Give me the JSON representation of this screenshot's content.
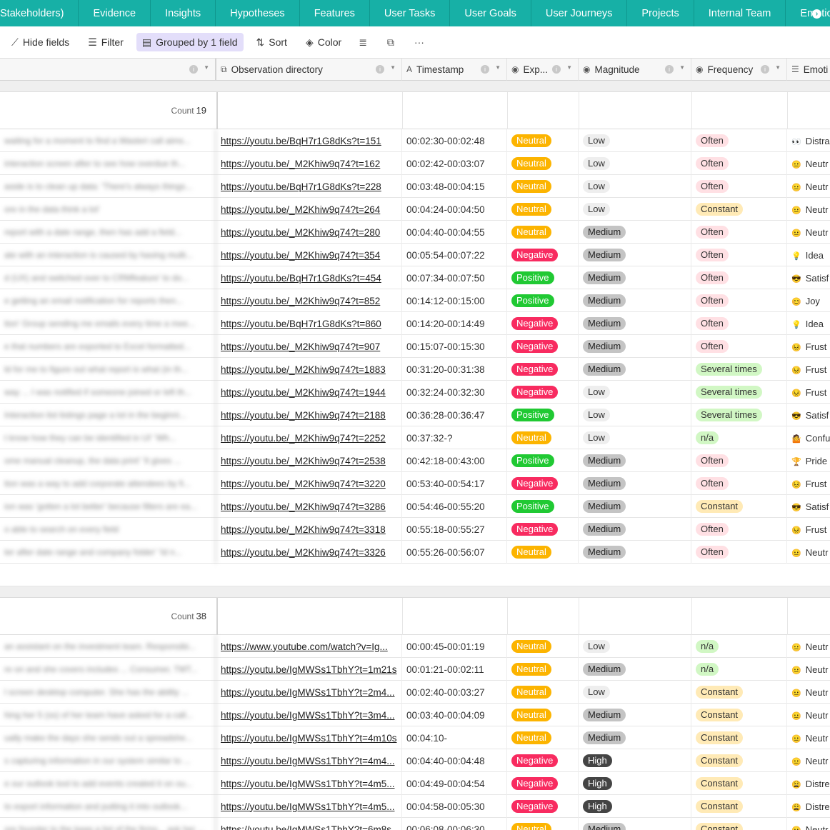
{
  "tabs": [
    {
      "label": "Stakeholders)"
    },
    {
      "label": "Evidence"
    },
    {
      "label": "Insights"
    },
    {
      "label": "Hypotheses"
    },
    {
      "label": "Features"
    },
    {
      "label": "User Tasks"
    },
    {
      "label": "User Goals"
    },
    {
      "label": "User Journeys"
    },
    {
      "label": "Projects"
    },
    {
      "label": "Internal Team"
    },
    {
      "label": "Emotio"
    }
  ],
  "toolbar": {
    "hide_fields": "Hide fields",
    "filter": "Filter",
    "grouped": "Grouped by 1 field",
    "sort": "Sort",
    "color": "Color"
  },
  "columns": {
    "observation": "Observation directory",
    "timestamp": "Timestamp",
    "experience": "Exp...",
    "magnitude": "Magnitude",
    "frequency": "Frequency",
    "emotion": "Emoti"
  },
  "groups": [
    {
      "count_label": "Count",
      "count": "19",
      "rows": [
        {
          "blur": "waiting for a moment to find a Wasteri call aims...",
          "link": "https://youtu.be/BqH7r1G8dKs?t=151",
          "time": "00:02:30-00:02:48",
          "exp": "Neutral",
          "mag": "Low",
          "freq": "Often",
          "emo_icon": "👀",
          "emo": "Distra"
        },
        {
          "blur": "interaction screen after to see how overdue th...",
          "link": "https://youtu.be/_M2Khiw9q74?t=162",
          "time": "00:02:42-00:03:07",
          "exp": "Neutral",
          "mag": "Low",
          "freq": "Often",
          "emo_icon": "😐",
          "emo": "Neutr"
        },
        {
          "blur": "aside is to clean up data: 'There's always things...",
          "link": "https://youtu.be/BqH7r1G8dKs?t=228",
          "time": "00:03:48-00:04:15",
          "exp": "Neutral",
          "mag": "Low",
          "freq": "Often",
          "emo_icon": "😐",
          "emo": "Neutr"
        },
        {
          "blur": "ore in the data think a lot'",
          "link": "https://youtu.be/_M2Khiw9q74?t=264",
          "time": "00:04:24-00:04:50",
          "exp": "Neutral",
          "mag": "Low",
          "freq": "Constant",
          "emo_icon": "😐",
          "emo": "Neutr"
        },
        {
          "blur": "report with a date range, then has add a field...",
          "link": "https://youtu.be/_M2Khiw9q74?t=280",
          "time": "00:04:40-00:04:55",
          "exp": "Neutral",
          "mag": "Medium",
          "freq": "Often",
          "emo_icon": "😐",
          "emo": "Neutr"
        },
        {
          "blur": "ate with an interaction is caused by having multi...",
          "link": "https://youtu.be/_M2Khiw9q74?t=354",
          "time": "00:05:54-00:07:22",
          "exp": "Negative",
          "mag": "Medium",
          "freq": "Often",
          "emo_icon": "💡",
          "emo": "Idea"
        },
        {
          "blur": "d (UX) and switched over to CRMfeature' to do...",
          "link": "https://youtu.be/BqH7r1G8dKs?t=454",
          "time": "00:07:34-00:07:50",
          "exp": "Positive",
          "mag": "Medium",
          "freq": "Often",
          "emo_icon": "😎",
          "emo": "Satisf"
        },
        {
          "blur": "e getting an email notification for reports then...",
          "link": "https://youtu.be/_M2Khiw9q74?t=852",
          "time": "00:14:12-00:15:00",
          "exp": "Positive",
          "mag": "Medium",
          "freq": "Often",
          "emo_icon": "😊",
          "emo": "Joy"
        },
        {
          "blur": "tion' Group sending me emails every time a mee...",
          "link": "https://youtu.be/BqH7r1G8dKs?t=860",
          "time": "00:14:20-00:14:49",
          "exp": "Negative",
          "mag": "Medium",
          "freq": "Often",
          "emo_icon": "💡",
          "emo": "Idea"
        },
        {
          "blur": "e that numbers are exported to Excel formatted...",
          "link": "https://youtu.be/_M2Khiw9q74?t=907",
          "time": "00:15:07-00:15:30",
          "exp": "Negative",
          "mag": "Medium",
          "freq": "Often",
          "emo_icon": "😣",
          "emo": "Frust"
        },
        {
          "blur": "ld for me to figure out what report is what (in th...",
          "link": "https://youtu.be/_M2Khiw9q74?t=1883",
          "time": "00:31:20-00:31:38",
          "exp": "Negative",
          "mag": "Medium",
          "freq": "Several times",
          "emo_icon": "😣",
          "emo": "Frust"
        },
        {
          "blur": "way ... I was notified if someone joined or left th...",
          "link": "https://youtu.be/_M2Khiw9q74?t=1944",
          "time": "00:32:24-00:32:30",
          "exp": "Negative",
          "mag": "Low",
          "freq": "Several times",
          "emo_icon": "😣",
          "emo": "Frust"
        },
        {
          "blur": "Interaction list listings page a lot in the beginni...",
          "link": "https://youtu.be/_M2Khiw9q74?t=2188",
          "time": "00:36:28-00:36:47",
          "exp": "Positive",
          "mag": "Low",
          "freq": "Several times",
          "emo_icon": "😎",
          "emo": "Satisf"
        },
        {
          "blur": "t know how they can be identified in UI' 'Wh...",
          "link": "https://youtu.be/_M2Khiw9q74?t=2252",
          "time": "00:37:32-?",
          "exp": "Neutral",
          "mag": "Low",
          "freq": "n/a",
          "emo_icon": "🤷",
          "emo": "Confu"
        },
        {
          "blur": "ome manual cleanup, the data print' 'It gives ...",
          "link": "https://youtu.be/_M2Khiw9q74?t=2538",
          "time": "00:42:18-00:43:00",
          "exp": "Positive",
          "mag": "Medium",
          "freq": "Often",
          "emo_icon": "🏆",
          "emo": "Pride"
        },
        {
          "blur": "tion was a way to add corporate attendees by fi...",
          "link": "https://youtu.be/_M2Khiw9q74?t=3220",
          "time": "00:53:40-00:54:17",
          "exp": "Negative",
          "mag": "Medium",
          "freq": "Often",
          "emo_icon": "😣",
          "emo": "Frust"
        },
        {
          "blur": "ion was 'gotten a lot better' because filters are ea...",
          "link": "https://youtu.be/_M2Khiw9q74?t=3286",
          "time": "00:54:46-00:55:20",
          "exp": "Positive",
          "mag": "Medium",
          "freq": "Constant",
          "emo_icon": "😎",
          "emo": "Satisf"
        },
        {
          "blur": "o able to search on every field",
          "link": "https://youtu.be/_M2Khiw9q74?t=3318",
          "time": "00:55:18-00:55:27",
          "exp": "Negative",
          "mag": "Medium",
          "freq": "Often",
          "emo_icon": "😣",
          "emo": "Frust"
        },
        {
          "blur": "ter after date range and company folder' 'Id n...",
          "link": "https://youtu.be/_M2Khiw9q74?t=3326",
          "time": "00:55:26-00:56:07",
          "exp": "Neutral",
          "mag": "Medium",
          "freq": "Often",
          "emo_icon": "😐",
          "emo": "Neutr"
        }
      ]
    },
    {
      "count_label": "Count",
      "count": "38",
      "rows": [
        {
          "blur": "an assistant on the investment team. Responsibi...",
          "link": "https://www.youtube.com/watch?v=Ig...",
          "time": "00:00:45-00:01:19",
          "exp": "Neutral",
          "mag": "Low",
          "freq": "n/a",
          "emo_icon": "😐",
          "emo": "Neutr"
        },
        {
          "blur": "re on and she covers includes ... Consumer, TMT...",
          "link": "https://youtu.be/IgMWSs1TbhY?t=1m21s",
          "time": "00:01:21-00:02:11",
          "exp": "Neutral",
          "mag": "Medium",
          "freq": "n/a",
          "emo_icon": "😐",
          "emo": "Neutr"
        },
        {
          "blur": "l screen desktop computer. She has the ability ...",
          "link": "https://youtu.be/IgMWSs1TbhY?t=2m4...",
          "time": "00:02:40-00:03:27",
          "exp": "Neutral",
          "mag": "Low",
          "freq": "Constant",
          "emo_icon": "😐",
          "emo": "Neutr"
        },
        {
          "blur": "hing her 5 (ss) of her team have asked for a call...",
          "link": "https://youtu.be/IgMWSs1TbhY?t=3m4...",
          "time": "00:03:40-00:04:09",
          "exp": "Neutral",
          "mag": "Medium",
          "freq": "Constant",
          "emo_icon": "😐",
          "emo": "Neutr"
        },
        {
          "blur": "ually make the days she sends out a spreadshe...",
          "link": "https://youtu.be/IgMWSs1TbhY?t=4m10s",
          "time": "00:04:10-",
          "exp": "Neutral",
          "mag": "Medium",
          "freq": "Constant",
          "emo_icon": "😐",
          "emo": "Neutr"
        },
        {
          "blur": "s capturing information in our system similar to ...",
          "link": "https://youtu.be/IgMWSs1TbhY?t=4m4...",
          "time": "00:04:40-00:04:48",
          "exp": "Negative",
          "mag": "High",
          "freq": "Constant",
          "emo_icon": "😐",
          "emo": "Neutr"
        },
        {
          "blur": "e our outlook tool to add events created it on ou...",
          "link": "https://youtu.be/IgMWSs1TbhY?t=4m5...",
          "time": "00:04:49-00:04:54",
          "exp": "Negative",
          "mag": "High",
          "freq": "Constant",
          "emo_icon": "😩",
          "emo": "Distre"
        },
        {
          "blur": "to export information and putting it into outlook...",
          "link": "https://youtu.be/IgMWSs1TbhY?t=4m5...",
          "time": "00:04:58-00:05:30",
          "exp": "Negative",
          "mag": "High",
          "freq": "Constant",
          "emo_icon": "😩",
          "emo": "Distre"
        },
        {
          "blur": "ore founder to the keep a list of the firms... ask her ...",
          "link": "https://youtu.be/IgMWSs1TbhY?t=6m8s",
          "time": "00:06:08-00:06:30",
          "exp": "Neutral",
          "mag": "Medium",
          "freq": "Constant",
          "emo_icon": "😐",
          "emo": "Neutr"
        }
      ]
    }
  ]
}
